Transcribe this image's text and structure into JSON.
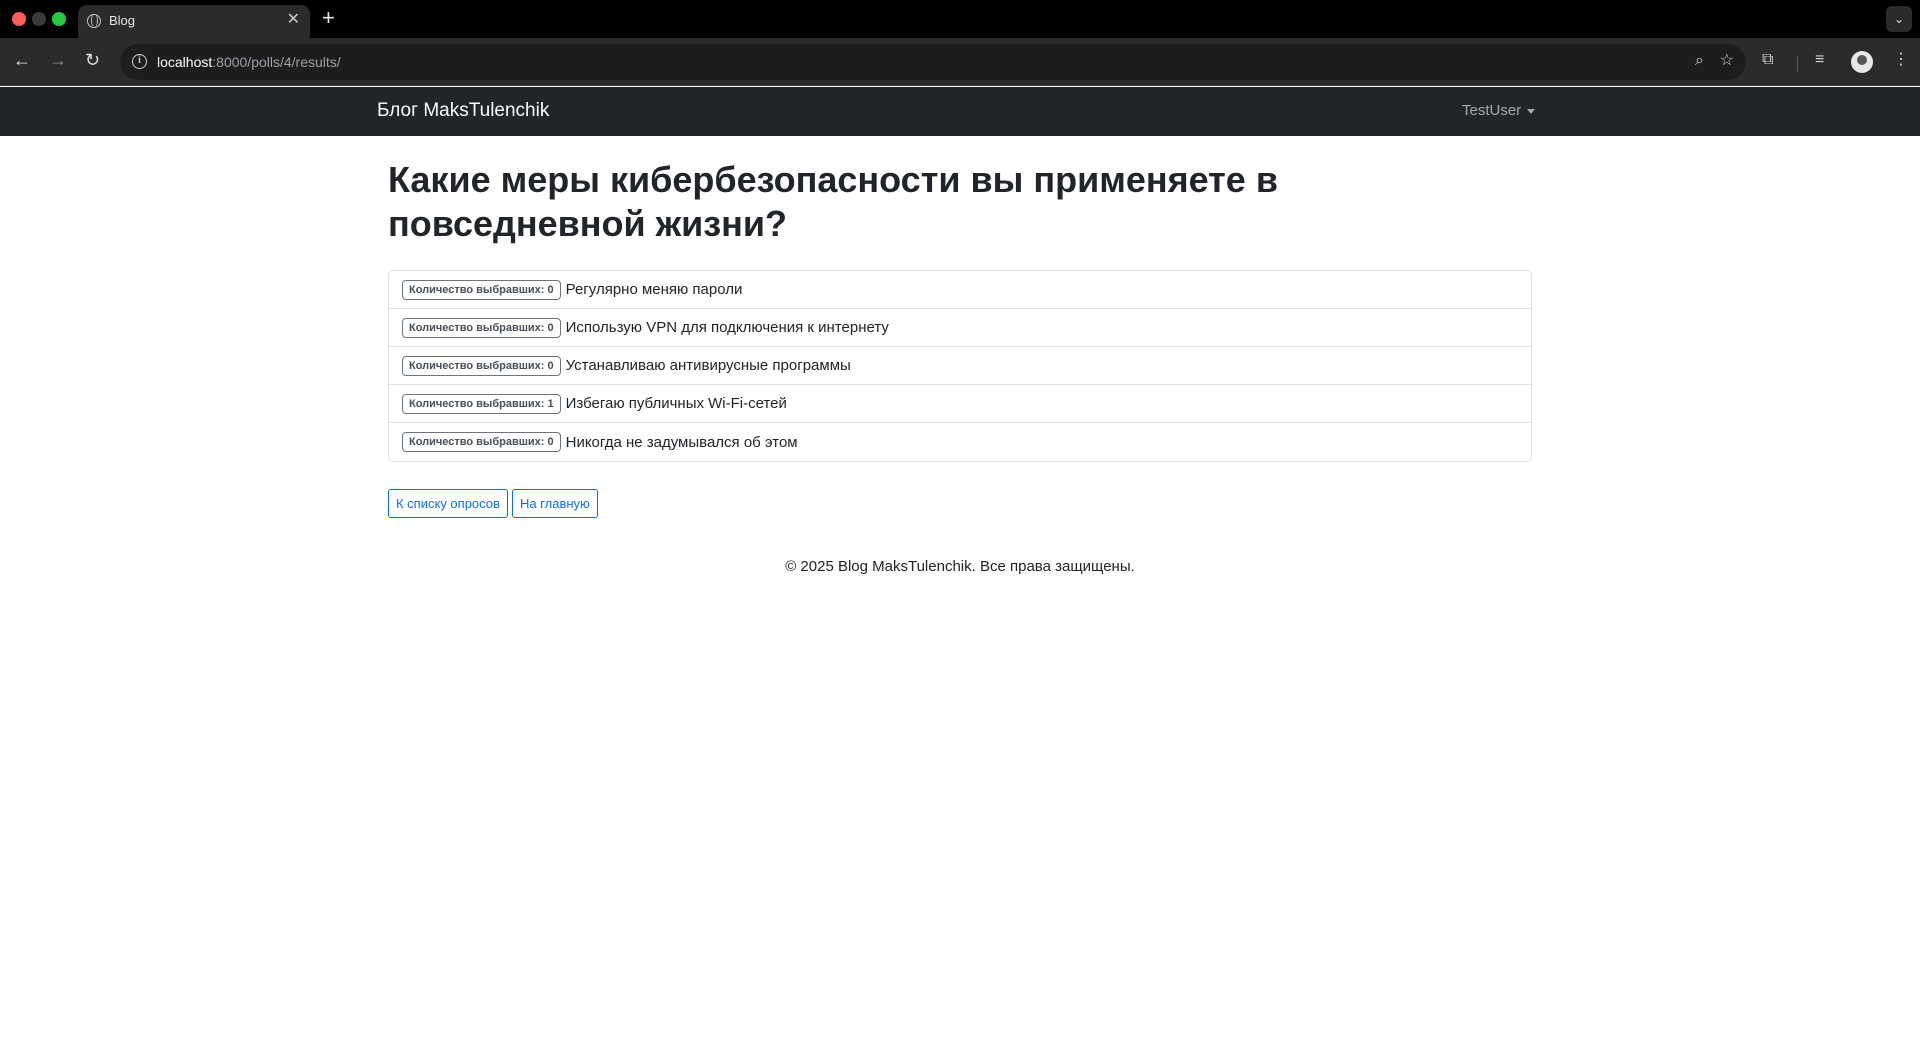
{
  "browser": {
    "tab_title": "Blog",
    "url_host": "localhost",
    "url_rest": ":8000/polls/4/results/"
  },
  "navbar": {
    "brand": "Блог MaksTulenchik",
    "user": "TestUser"
  },
  "poll": {
    "question": "Какие меры кибербезопасности вы применяете в повседневной жизни?",
    "choices": [
      {
        "badge": "Количество выбравших: 0",
        "text": "Регулярно меняю пароли"
      },
      {
        "badge": "Количество выбравших: 0",
        "text": "Использую VPN для подключения к интернету"
      },
      {
        "badge": "Количество выбравших: 0",
        "text": "Устанавливаю антивирусные программы"
      },
      {
        "badge": "Количество выбравших: 1",
        "text": "Избегаю публичных Wi-Fi-сетей"
      },
      {
        "badge": "Количество выбравших: 0",
        "text": "Никогда не задумывался об этом"
      }
    ]
  },
  "buttons": {
    "polls_list": "К списку опросов",
    "home": "На главную"
  },
  "footer": {
    "text": "© 2025 Blog MaksTulenchik. Все права защищены."
  }
}
